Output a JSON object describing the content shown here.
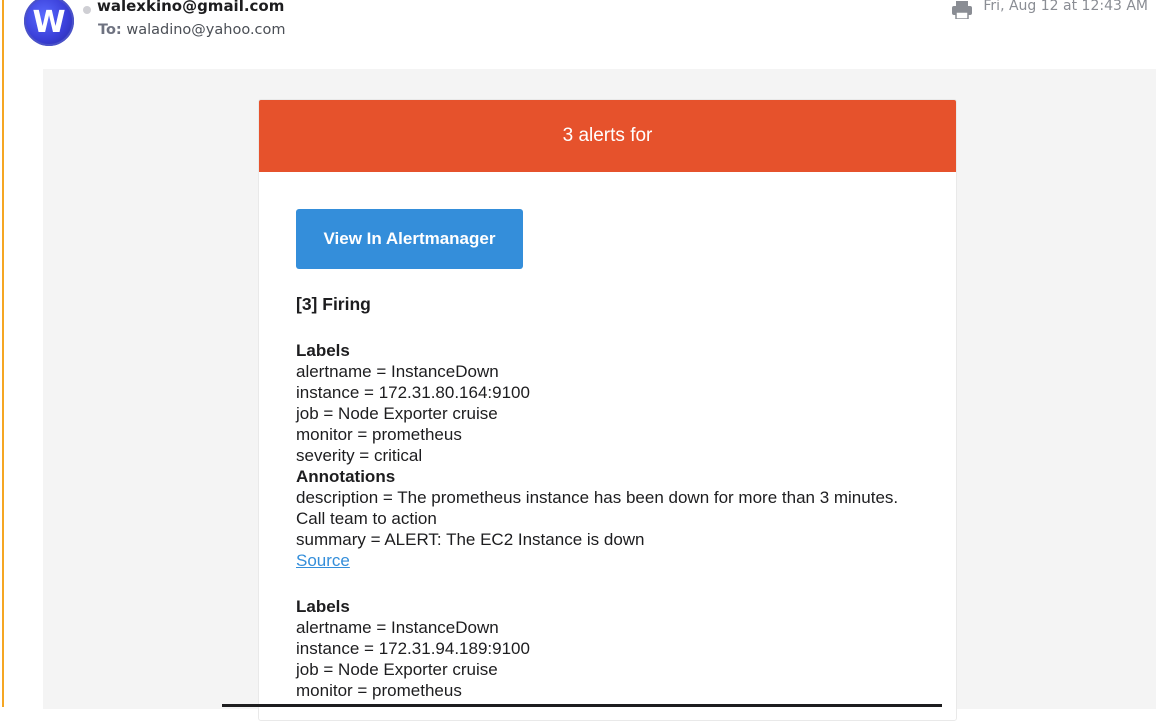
{
  "header": {
    "from": "walexkino@gmail.com",
    "to_label": "To:",
    "to": "waladino@yahoo.com",
    "date": "Fri, Aug 12 at 12:43 AM",
    "avatar_letter": "W"
  },
  "email": {
    "banner_title": "3 alerts for",
    "button_label": "View In Alertmanager",
    "firing_title": "[3] Firing",
    "alerts": [
      {
        "labels_heading": "Labels",
        "labels": [
          "alertname = InstanceDown",
          "instance = 172.31.80.164:9100",
          "job = Node Exporter cruise",
          "monitor = prometheus",
          "severity = critical"
        ],
        "annotations_heading": "Annotations",
        "annotations": [
          "description = The prometheus instance has been down for more than 3 minutes. Call team to action",
          "summary = ALERT: The EC2 Instance is down"
        ],
        "source_label": "Source"
      },
      {
        "labels_heading": "Labels",
        "labels": [
          "alertname = InstanceDown",
          "instance = 172.31.94.189:9100",
          "job = Node Exporter cruise",
          "monitor = prometheus"
        ]
      }
    ]
  },
  "colors": {
    "banner": "#e6522c",
    "button": "#348eda",
    "link": "#348eda",
    "accent": "#f5a623"
  }
}
